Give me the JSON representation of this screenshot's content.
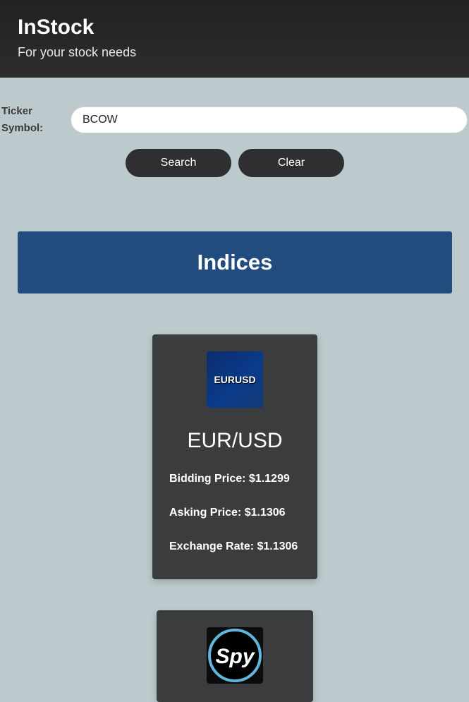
{
  "header": {
    "title": "InStock",
    "subtitle": "For your stock needs"
  },
  "search": {
    "label": "Ticker Symbol:",
    "value": "BCOW",
    "search_label": "Search",
    "clear_label": "Clear"
  },
  "section": {
    "title": "Indices"
  },
  "cards": [
    {
      "logo_text": "EURUSD",
      "name": "EUR/USD",
      "fields": [
        "Bidding Price: $1.1299",
        "Asking Price: $1.1306",
        "Exchange Rate: $1.1306"
      ]
    },
    {
      "logo_text": "Spy"
    }
  ],
  "colors": {
    "background": "#bccacd",
    "header": "#2a2828",
    "button": "#2f2f31",
    "banner": "#224c7d",
    "card": "#3a3c3e",
    "spy_ring": "#5fb6de"
  }
}
